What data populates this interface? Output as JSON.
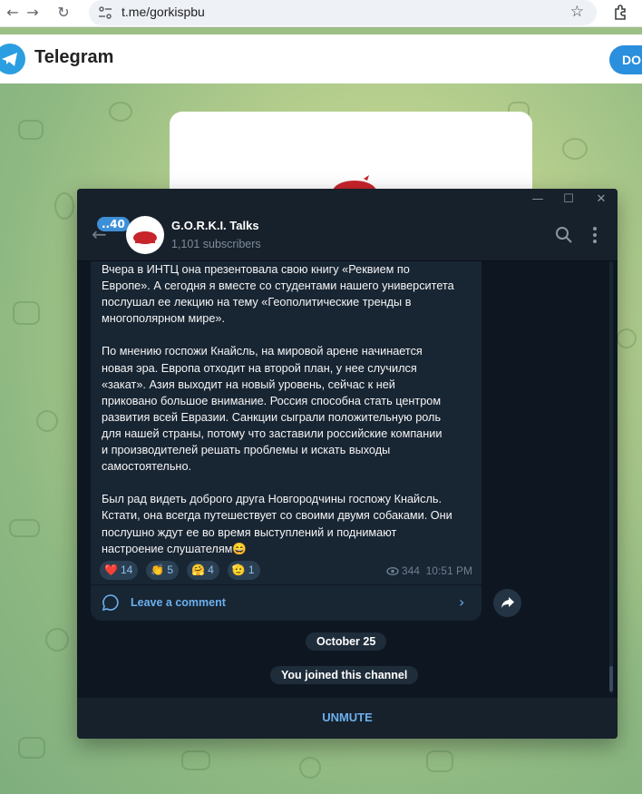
{
  "browser": {
    "url": "t.me/gorkispbu"
  },
  "site": {
    "title": "Telegram",
    "download_label": "DO"
  },
  "window": {
    "minimize": "—",
    "maximize": "☐",
    "close": "✕"
  },
  "channel": {
    "name": "G.O.R.K.I. Talks",
    "subscribers": "1,101 subscribers",
    "unread_badge": "..40"
  },
  "post": {
    "text": "Вчера в ИНТЦ она презентовала свою книгу «Реквием по\nЕвропе». А сегодня я вместе со студентами нашего университета\nпослушал ее лекцию на тему «Геополитические тренды в\nмногополярном мире».\n\nПо мнению госпожи Кнайсль, на мировой арене начинается\nновая эра. Европа отходит на второй план, у нее случился\n«закат». Азия выходит на новый уровень, сейчас к ней\nприковано большое внимание. Россия способна стать центром\nразвития всей Евразии. Санкции сыграли положительную роль\nдля нашей страны, потому что заставили российские компании\nи производителей решать проблемы и искать выходы\nсамостоятельно.\n\nБыл рад видеть доброго друга Новгородчины госпожу Кнайсль.\nКстати, она всегда путешествует со своими двумя собаками. Они\nпослушно ждут ее во время выступлений и поднимают\nнастроение слушателям😄",
    "reactions": [
      {
        "emoji": "❤️",
        "count": "14"
      },
      {
        "emoji": "👏",
        "count": "5"
      },
      {
        "emoji": "🤗",
        "count": "4"
      },
      {
        "emoji": "🫡",
        "count": "1"
      }
    ],
    "views": "344",
    "time": "10:51 PM",
    "comment_label": "Leave a comment"
  },
  "service": {
    "date": "October 25",
    "joined": "You joined this channel"
  },
  "footer": {
    "unmute_label": "UNMUTE"
  },
  "colors": {
    "accent": "#6cb0ee",
    "app_bg": "#0e1621",
    "panel_bg": "#17212b",
    "bubble_bg": "#182533",
    "telegram_blue": "#2a9ee0"
  },
  "icons": {
    "back": "arrow-left-icon",
    "search": "search-icon",
    "menu": "kebab-menu-icon",
    "comment": "comment-bubble-icon",
    "chevron": "chevron-right-icon",
    "share": "share-arrow-icon",
    "views": "eye-icon"
  }
}
